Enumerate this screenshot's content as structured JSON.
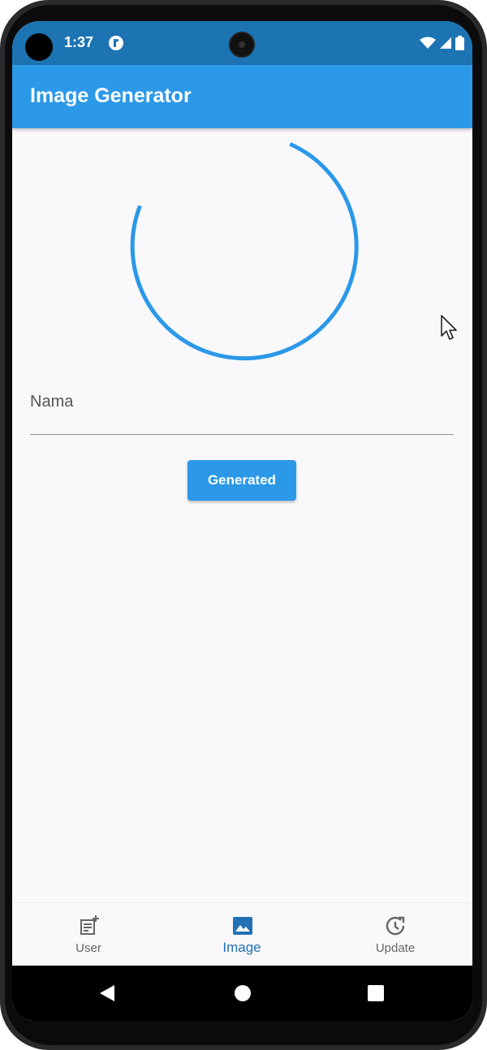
{
  "status_bar": {
    "time": "1:37",
    "icons": [
      "wifi-icon",
      "signal-icon",
      "battery-icon"
    ]
  },
  "app_bar": {
    "title": "Image Generator"
  },
  "loading": {
    "indicator": "circular-progress",
    "color": "#2b98e8"
  },
  "form": {
    "name_label": "Nama",
    "name_value": "",
    "button_label": "Generated"
  },
  "bottom_nav": {
    "items": [
      {
        "label": "User",
        "icon": "post-add-icon",
        "active": false
      },
      {
        "label": "Image",
        "icon": "image-icon",
        "active": true
      },
      {
        "label": "Update",
        "icon": "update-icon",
        "active": false
      }
    ]
  },
  "colors": {
    "primary": "#2b98e8",
    "status_bar": "#1c74b3",
    "active_nav": "#2270b5",
    "background": "#f9f8fb"
  }
}
